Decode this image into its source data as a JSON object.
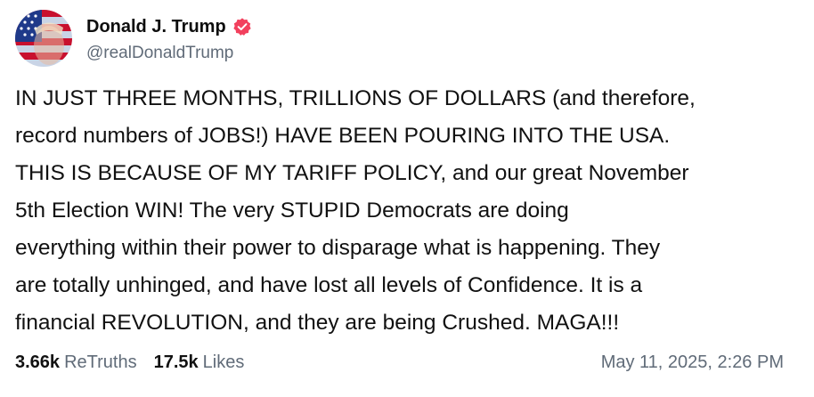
{
  "post": {
    "author": {
      "display_name": "Donald J. Trump",
      "handle": "@realDonaldTrump",
      "verified_icon": "verified-badge-icon",
      "badge_color": "#f2405d"
    },
    "body": "IN JUST THREE MONTHS, TRILLIONS OF DOLLARS (and therefore,\nrecord numbers of JOBS!) HAVE BEEN POURING INTO THE USA.\nTHIS IS BECAUSE OF MY TARIFF POLICY, and our great November\n5th Election WIN! The very STUPID Democrats are doing\neverything within their power to disparage what is happening. They\nare totally unhinged, and have lost all levels of Confidence. It is a\nfinancial REVOLUTION, and they are being Crushed. MAGA!!!",
    "stats": {
      "retruths_count": "3.66k",
      "retruths_label": "ReTruths",
      "likes_count": "17.5k",
      "likes_label": "Likes"
    },
    "timestamp": "May 11, 2025, 2:26 PM"
  }
}
